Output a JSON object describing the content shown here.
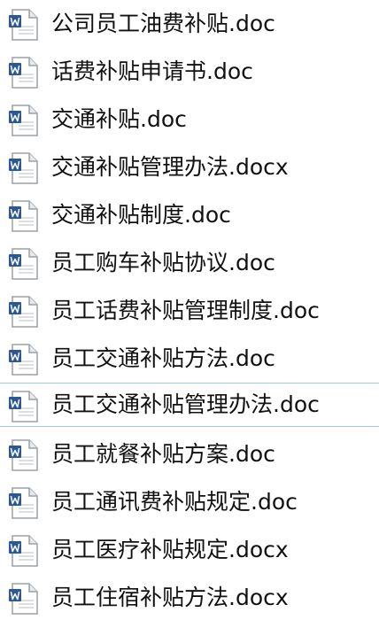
{
  "files": [
    {
      "name": "公司员工油费补贴.doc",
      "icon": "word-document-icon"
    },
    {
      "name": "话费补贴申请书.doc",
      "icon": "word-document-icon"
    },
    {
      "name": "交通补贴.doc",
      "icon": "word-document-icon"
    },
    {
      "name": "交通补贴管理办法.docx",
      "icon": "word-document-icon"
    },
    {
      "name": "交通补贴制度.doc",
      "icon": "word-document-icon"
    },
    {
      "name": "员工购车补贴协议.doc",
      "icon": "word-document-icon"
    },
    {
      "name": "员工话费补贴管理制度.doc",
      "icon": "word-document-icon"
    },
    {
      "name": "员工交通补贴方法.doc",
      "icon": "word-document-icon"
    },
    {
      "name": "员工交通补贴管理办法.doc",
      "icon": "word-document-icon"
    },
    {
      "name": "员工就餐补贴方案.doc",
      "icon": "word-document-icon"
    },
    {
      "name": "员工通讯费补贴规定.doc",
      "icon": "word-document-icon"
    },
    {
      "name": "员工医疗补贴规定.docx",
      "icon": "word-document-icon"
    },
    {
      "name": "员工住宿补贴方法.docx",
      "icon": "word-document-icon"
    }
  ],
  "focused_index": 8,
  "colors": {
    "focus_border": "#9ccfe6",
    "word_blue": "#2b5797",
    "page_fill": "#ffffff",
    "page_outline": "#9aa0a6"
  }
}
